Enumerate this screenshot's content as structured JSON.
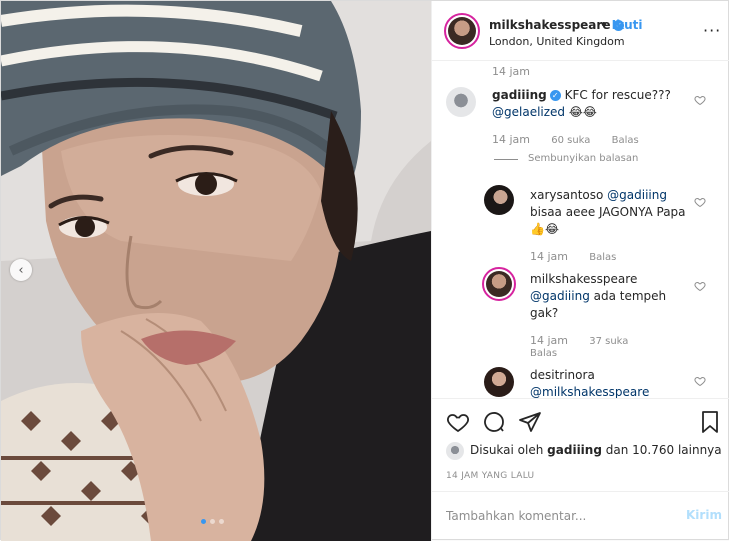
{
  "header": {
    "username": "milkshakesspeare",
    "follow_label": "Ikuti",
    "dot": "•",
    "location": "London, United Kingdom",
    "more": "···"
  },
  "comments": {
    "top_time": "14 jam",
    "items": [
      {
        "user": "gadiiing",
        "text": "KFC for rescue???",
        "mention": "@gelaelized",
        "emoji": "😂😂",
        "time": "14 jam",
        "likes": "60 suka",
        "reply": "Balas"
      },
      {
        "user": "xarysantoso",
        "mention": "@gadiiing",
        "text": "bisaa aeee JAGONYA Papa",
        "emoji": "👍😂",
        "time": "14 jam",
        "reply": "Balas"
      },
      {
        "user": "milkshakesspeare",
        "mention": "@gadiiing",
        "text": "ada tempeh gak?",
        "time": "14 jam",
        "likes": "37 suka",
        "reply": "Balas"
      },
      {
        "user": "desitrinora",
        "mention": "@milkshakesspeare"
      }
    ],
    "hide_replies": "Sembunyikan balasan"
  },
  "liked": {
    "prefix": "Disukai oleh",
    "user": "gadiiing",
    "suffix": "dan 10.760 lainnya"
  },
  "time_ago": "14 JAM YANG LALU",
  "add_comment": {
    "placeholder": "Tambahkan komentar...",
    "post_label": "Kirim"
  },
  "icons": {
    "like": "heart-icon",
    "comment": "comment-icon",
    "share": "share-icon",
    "save": "bookmark-icon"
  },
  "colors": {
    "accent": "#3897f0",
    "mention": "#003569",
    "muted": "#8e8e8e"
  }
}
